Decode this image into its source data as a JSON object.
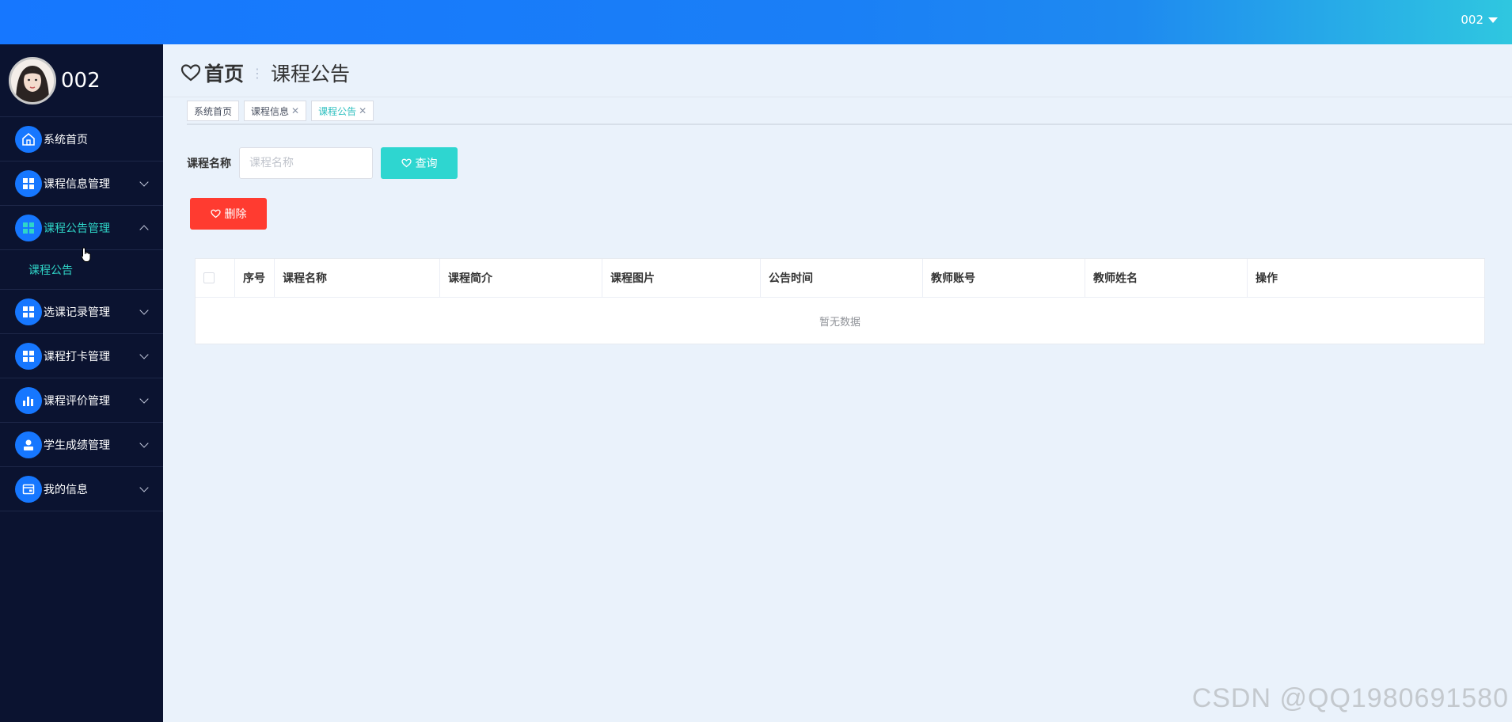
{
  "topbar": {
    "user_label": "002"
  },
  "sidebar": {
    "profile_name": "002",
    "items": [
      {
        "label": "系统首页",
        "icon": "home-icon",
        "expandable": false
      },
      {
        "label": "课程信息管理",
        "icon": "grid-icon",
        "expandable": true
      },
      {
        "label": "课程公告管理",
        "icon": "grid-icon",
        "expandable": true,
        "expanded": true,
        "children": [
          {
            "label": "课程公告"
          }
        ]
      },
      {
        "label": "选课记录管理",
        "icon": "grid-icon",
        "expandable": true
      },
      {
        "label": "课程打卡管理",
        "icon": "grid-icon",
        "expandable": true
      },
      {
        "label": "课程评价管理",
        "icon": "bar-chart-icon",
        "expandable": true
      },
      {
        "label": "学生成绩管理",
        "icon": "person-icon",
        "expandable": true
      },
      {
        "label": "我的信息",
        "icon": "card-icon",
        "expandable": true
      }
    ]
  },
  "header": {
    "home": "首页",
    "separator": "⋮",
    "current": "课程公告"
  },
  "tabs": [
    {
      "label": "系统首页",
      "closable": false,
      "active": false
    },
    {
      "label": "课程信息",
      "closable": true,
      "active": false
    },
    {
      "label": "课程公告",
      "closable": true,
      "active": true
    }
  ],
  "search": {
    "label": "课程名称",
    "placeholder": "课程名称",
    "value": "",
    "query_label": "查询"
  },
  "actions": {
    "delete_label": "删除"
  },
  "table": {
    "columns": [
      "序号",
      "课程名称",
      "课程简介",
      "课程图片",
      "公告时间",
      "教师账号",
      "教师姓名",
      "操作"
    ],
    "empty_text": "暂无数据"
  },
  "watermark": "CSDN @QQ1980691580",
  "colors": {
    "primary": "#1677ff",
    "accent": "#2ed6d0",
    "danger": "#ff3b30",
    "sidebar_bg": "#0b1330"
  }
}
